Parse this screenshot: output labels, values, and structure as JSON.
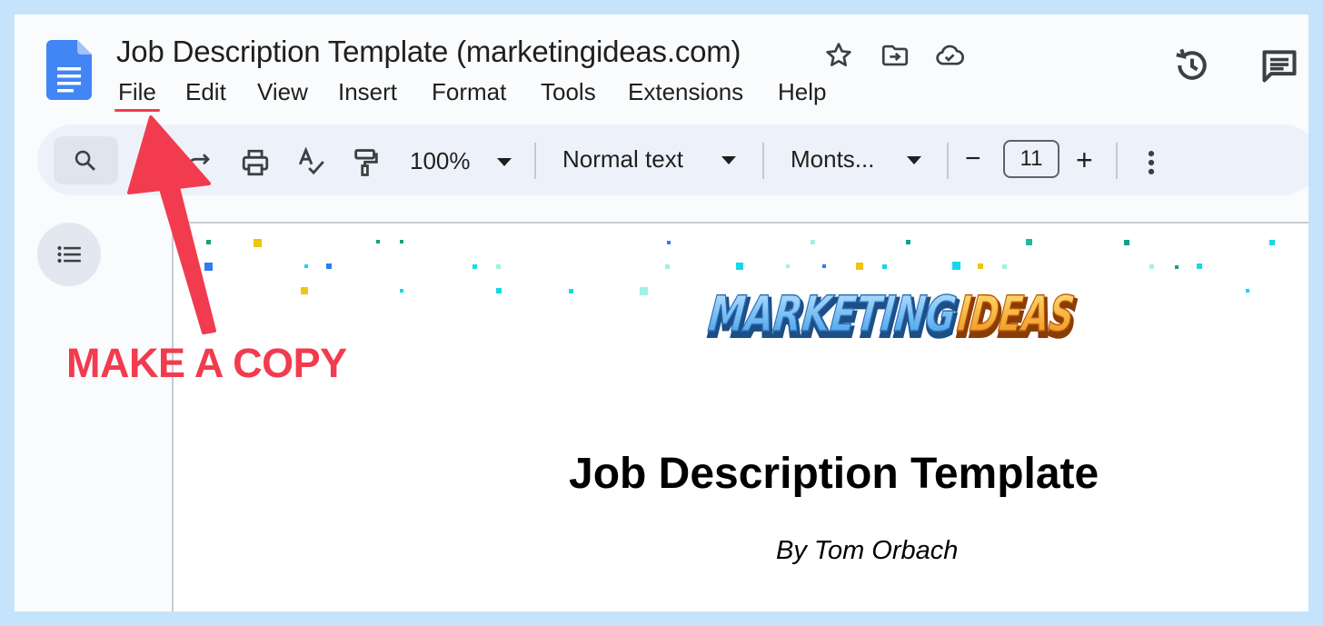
{
  "document": {
    "title": "Job Description Template (marketingideas.com)"
  },
  "menu": {
    "items": [
      "File",
      "Edit",
      "View",
      "Insert",
      "Format",
      "Tools",
      "Extensions",
      "Help"
    ]
  },
  "toolbar": {
    "zoom": "100%",
    "style": "Normal text",
    "font": "Monts...",
    "font_size": "11",
    "minus": "−",
    "plus": "+"
  },
  "page": {
    "logo_text_part1": "MARKETING",
    "logo_text_part2": "IDEAS",
    "heading": "Job Description Template",
    "byline": "By Tom Orbach"
  },
  "annotation": {
    "label": "MAKE A COPY",
    "color": "#f23b4e"
  },
  "colors": {
    "background": "#c5e3fb",
    "docs_blue": "#4285f4",
    "toolbar_bg": "#edf2fa"
  }
}
